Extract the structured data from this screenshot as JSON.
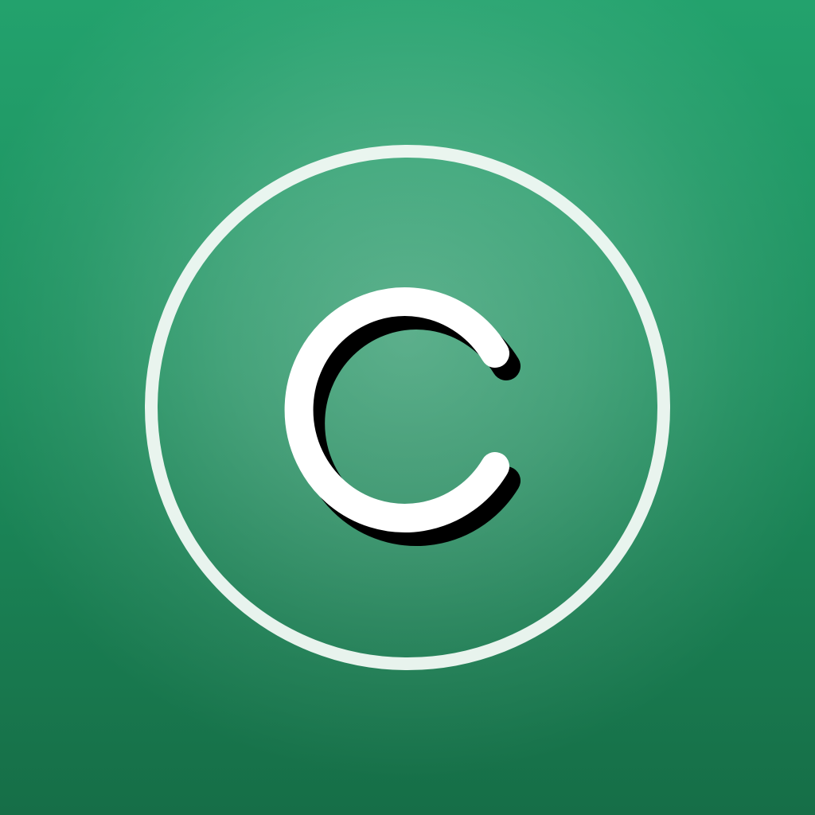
{
  "icon": {
    "letter": "C",
    "icon_name": "copyright-c-icon"
  },
  "colors": {
    "background_top": "#23a26d",
    "background_bottom": "#166e47",
    "ring": "#f0f8f4",
    "letter": "#ffffff",
    "letter_shadow": "#000000"
  }
}
